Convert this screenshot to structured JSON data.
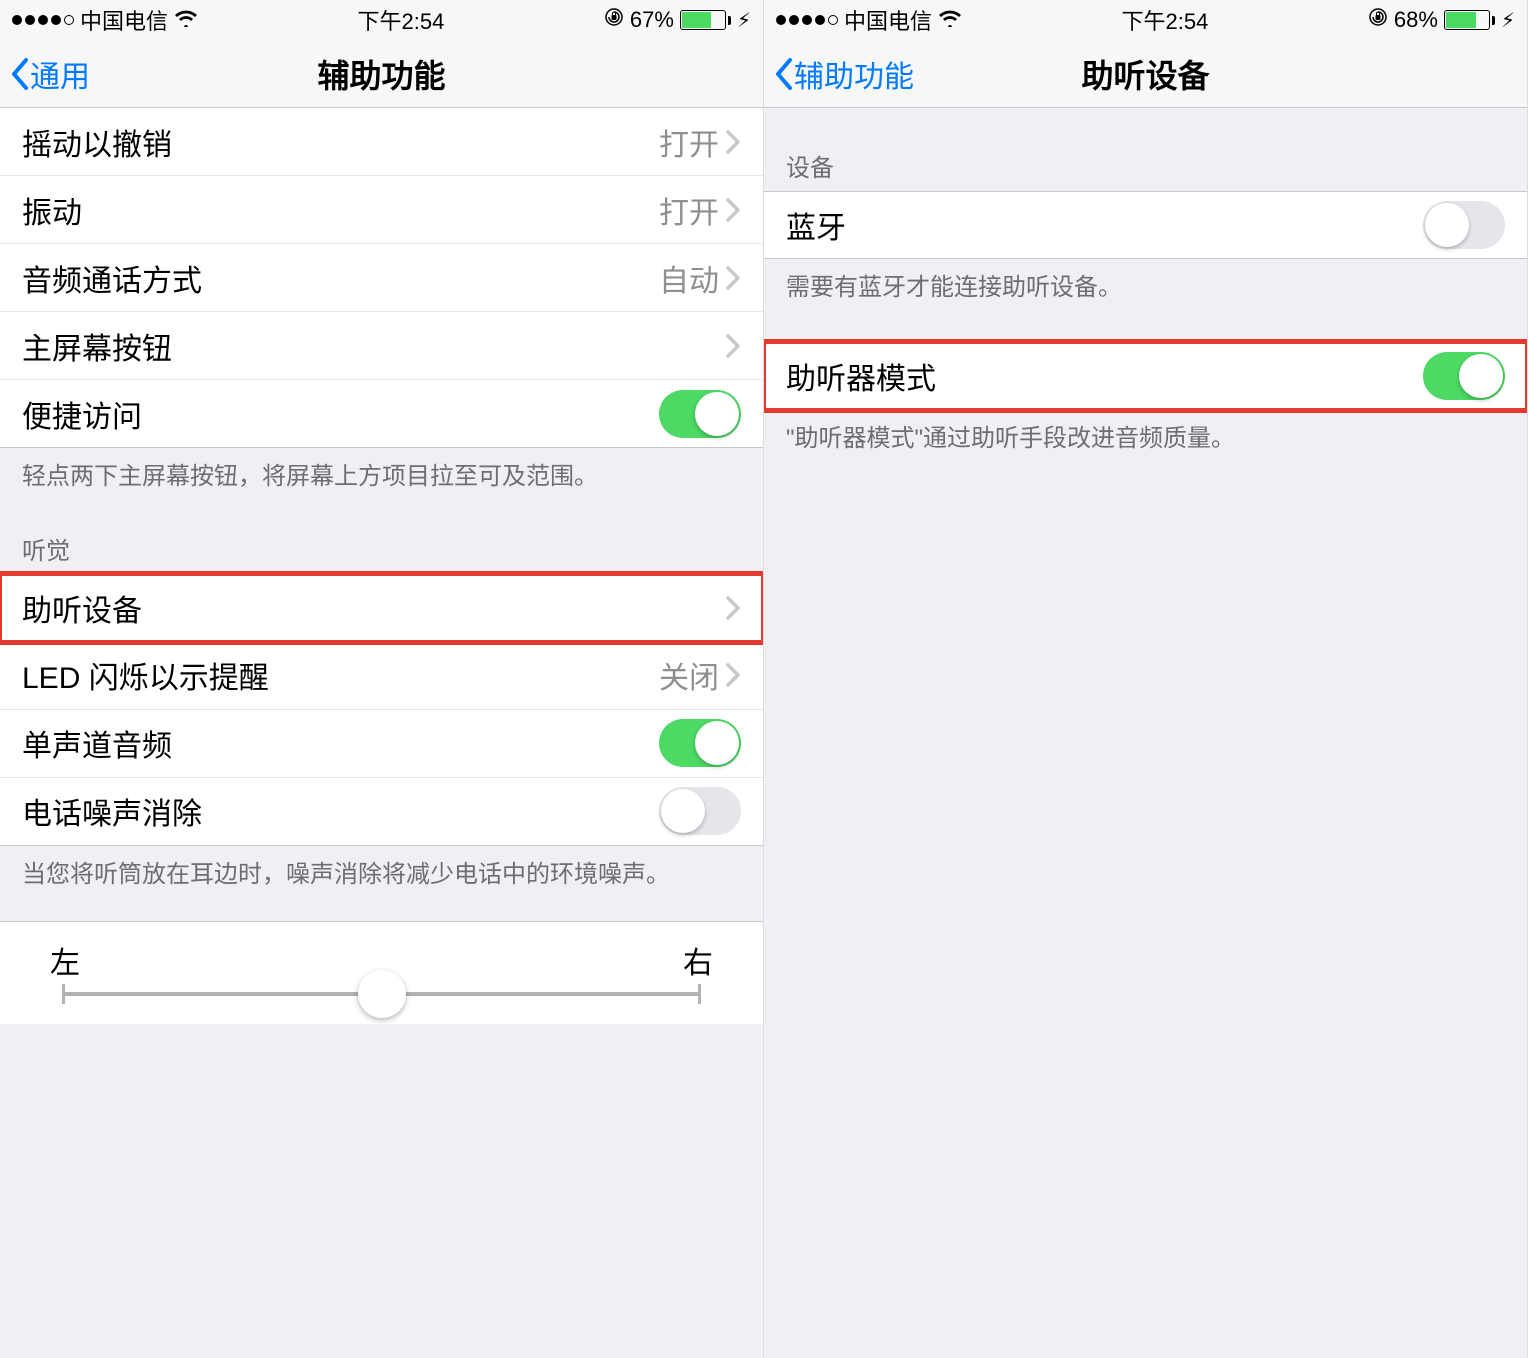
{
  "left": {
    "status": {
      "carrier": "中国电信",
      "time": "下午2:54",
      "battery_pct": "67%",
      "battery_fill_pct": 67
    },
    "nav": {
      "back": "通用",
      "title": "辅助功能"
    },
    "rows": {
      "shake_to_undo": {
        "label": "摇动以撤销",
        "value": "打开"
      },
      "vibration": {
        "label": "振动",
        "value": "打开"
      },
      "call_audio_routing": {
        "label": "音频通话方式",
        "value": "自动"
      },
      "home_button": {
        "label": "主屏幕按钮"
      },
      "reachability": {
        "label": "便捷访问"
      }
    },
    "reachability_footer": "轻点两下主屏幕按钮，将屏幕上方项目拉至可及范围。",
    "hearing_header": "听觉",
    "hearing": {
      "hearing_devices": {
        "label": "助听设备"
      },
      "led_flash": {
        "label": "LED 闪烁以示提醒",
        "value": "关闭"
      },
      "mono_audio": {
        "label": "单声道音频"
      },
      "noise_cancellation": {
        "label": "电话噪声消除"
      }
    },
    "noise_footer": "当您将听筒放在耳边时，噪声消除将减少电话中的环境噪声。",
    "slider": {
      "left": "左",
      "right": "右"
    }
  },
  "right": {
    "status": {
      "carrier": "中国电信",
      "time": "下午2:54",
      "battery_pct": "68%",
      "battery_fill_pct": 68
    },
    "nav": {
      "back": "辅助功能",
      "title": "助听设备"
    },
    "devices_header": "设备",
    "bluetooth": {
      "label": "蓝牙"
    },
    "bluetooth_footer": "需要有蓝牙才能连接助听设备。",
    "hearing_aid_mode": {
      "label": "助听器模式"
    },
    "hearing_aid_footer": "\"助听器模式\"通过助听手段改进音频质量。"
  },
  "colors": {
    "ios_blue": "#007aff",
    "ios_green": "#4cd964",
    "highlight_red": "#e4392e"
  }
}
